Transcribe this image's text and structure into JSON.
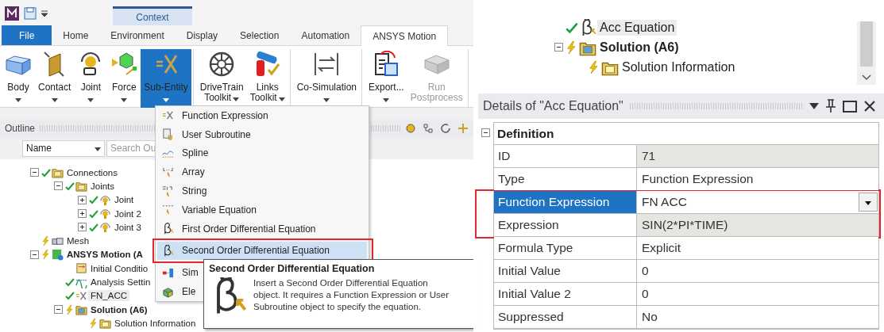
{
  "quick_access": {
    "context_tab": "Context"
  },
  "ribbon_tabs": [
    {
      "label": "File",
      "kind": "file",
      "selected": false
    },
    {
      "label": "Home",
      "kind": "tab",
      "selected": false
    },
    {
      "label": "Environment",
      "kind": "tab",
      "selected": false
    },
    {
      "label": "Display",
      "kind": "tab",
      "selected": false
    },
    {
      "label": "Selection",
      "kind": "tab",
      "selected": false
    },
    {
      "label": "Automation",
      "kind": "tab",
      "selected": false
    },
    {
      "label": "ANSYS Motion",
      "kind": "tab",
      "selected": true
    }
  ],
  "ribbon": {
    "groups": [
      {
        "buttons": [
          {
            "label": "Body",
            "kind": "body",
            "caret": true,
            "selected": false,
            "disabled": false
          },
          {
            "label": "Contact",
            "kind": "contact",
            "caret": true,
            "selected": false,
            "disabled": false
          },
          {
            "label": "Joint",
            "kind": "joint",
            "caret": true,
            "selected": false,
            "disabled": false
          },
          {
            "label": "Force",
            "kind": "force",
            "caret": true,
            "selected": false,
            "disabled": false
          },
          {
            "label": "Sub-Entity",
            "kind": "subentity",
            "caret": true,
            "selected": true,
            "disabled": false
          }
        ]
      },
      {
        "buttons": [
          {
            "label": "DriveTrain Toolkit",
            "kind": "drivetrain",
            "caret": true,
            "selected": false,
            "disabled": false
          },
          {
            "label": "Links Toolkit",
            "kind": "links",
            "caret": true,
            "selected": false,
            "disabled": false
          }
        ]
      },
      {
        "buttons": [
          {
            "label": "Co-Simulation",
            "kind": "cosim",
            "caret": true,
            "selected": false,
            "disabled": false
          }
        ]
      },
      {
        "buttons": [
          {
            "label": "Export...",
            "kind": "export",
            "caret": true,
            "selected": false,
            "disabled": false
          },
          {
            "label": "Run Postprocess",
            "kind": "postprocess",
            "caret": false,
            "selected": false,
            "disabled": true
          }
        ]
      }
    ]
  },
  "outline": {
    "title": "Outline",
    "filter": {
      "value": "Name"
    },
    "search": {
      "placeholder": "Search Ou"
    },
    "tree": [
      {
        "label": "Connections",
        "kind": "folder",
        "checked": true,
        "needs_update": false,
        "expanded": true,
        "bold": false,
        "selected": false,
        "children": [
          {
            "label": "Joints",
            "kind": "joints",
            "checked": true,
            "needs_update": false,
            "expanded": true,
            "bold": false,
            "selected": false,
            "children": [
              {
                "label": "Joint",
                "kind": "joint",
                "checked": true,
                "needs_update": false,
                "expanded": false,
                "bold": false,
                "selected": false
              },
              {
                "label": "Joint 2",
                "kind": "joint",
                "checked": true,
                "needs_update": false,
                "expanded": false,
                "bold": false,
                "selected": false
              },
              {
                "label": "Joint 3",
                "kind": "joint",
                "checked": true,
                "needs_update": false,
                "expanded": false,
                "bold": false,
                "selected": false
              }
            ]
          }
        ]
      },
      {
        "label": "Mesh",
        "kind": "mesh",
        "checked": false,
        "needs_update": true,
        "bold": false,
        "selected": false
      },
      {
        "label": "ANSYS Motion (A",
        "kind": "motion",
        "checked": false,
        "needs_update": true,
        "expanded": true,
        "bold": true,
        "selected": false,
        "children": [
          {
            "label": "Initial Conditio",
            "kind": "conditions",
            "checked": false,
            "needs_update": false,
            "bold": false,
            "selected": false
          },
          {
            "label": "Analysis Settin",
            "kind": "settings",
            "checked": true,
            "needs_update": false,
            "bold": false,
            "selected": false
          },
          {
            "label": "FN_ACC",
            "kind": "function",
            "checked": true,
            "needs_update": false,
            "bold": false,
            "selected": true
          },
          {
            "label": "Solution (A6)",
            "kind": "solution",
            "checked": false,
            "needs_update": true,
            "expanded": true,
            "bold": true,
            "selected": false,
            "children": [
              {
                "label": "Solution Information",
                "kind": "info",
                "checked": false,
                "needs_update": true,
                "bold": false,
                "selected": false
              }
            ]
          }
        ]
      }
    ]
  },
  "menu": {
    "items": [
      {
        "label": "Function Expression",
        "kind": "function",
        "selected": false,
        "framed": false
      },
      {
        "label": "User Subroutine",
        "kind": "subroutine",
        "selected": false,
        "framed": false
      },
      {
        "label": "Spline",
        "kind": "spline",
        "selected": false,
        "framed": false
      },
      {
        "label": "Array",
        "kind": "array",
        "selected": false,
        "framed": false
      },
      {
        "label": "String",
        "kind": "string",
        "selected": false,
        "framed": false
      },
      {
        "label": "Variable Equation",
        "kind": "variable",
        "selected": false,
        "framed": false
      },
      {
        "label": "First Order Differential Equation",
        "kind": "first_order",
        "selected": false,
        "framed": false
      },
      {
        "label": "Second Order Differential Equation",
        "kind": "second_order",
        "selected": true,
        "framed": true
      },
      {
        "label": "Sim",
        "kind": "simulink",
        "selected": false,
        "framed": false
      },
      {
        "label": "Ele",
        "kind": "element",
        "selected": false,
        "framed": false
      }
    ]
  },
  "tooltip": {
    "title": "Second Order Differential Equation",
    "text": "Insert a Second Order Differential Equation object. It requires a Function Expression or User Subroutine object to specify the equation."
  },
  "right_tree": [
    {
      "label": "Acc Equation",
      "kind": "second_order",
      "checked": true,
      "needs_update": false,
      "bold": false,
      "selected": true
    },
    {
      "label": "Solution (A6)",
      "kind": "solution",
      "checked": false,
      "needs_update": true,
      "expanded": true,
      "bold": true,
      "selected": false,
      "children": [
        {
          "label": "Solution Information",
          "kind": "info",
          "checked": false,
          "needs_update": true,
          "bold": false,
          "selected": false
        }
      ]
    }
  ],
  "details": {
    "title": "Details of \"Acc Equation\"",
    "group": {
      "label": "Definition",
      "expanded": true
    },
    "rows": [
      {
        "label": "ID",
        "value": "71",
        "kind": "text",
        "readonly": true,
        "selected": false,
        "framed": false
      },
      {
        "label": "Type",
        "value": "Function Expression",
        "kind": "text",
        "readonly": false,
        "selected": false,
        "framed": false
      },
      {
        "label": "Function Expression",
        "value": "FN ACC",
        "kind": "dropdown",
        "readonly": false,
        "selected": true,
        "framed": true
      },
      {
        "label": "Expression",
        "value": "SIN(2*PI*TIME)",
        "kind": "text",
        "readonly": true,
        "selected": false,
        "framed": true
      },
      {
        "label": "Formula Type",
        "value": "Explicit",
        "kind": "text",
        "readonly": false,
        "selected": false,
        "framed": false
      },
      {
        "label": "Initial Value",
        "value": "0",
        "kind": "text",
        "readonly": false,
        "selected": false,
        "framed": false
      },
      {
        "label": "Initial Value 2",
        "value": "0",
        "kind": "text",
        "readonly": false,
        "selected": false,
        "framed": false
      },
      {
        "label": "Suppressed",
        "value": "No",
        "kind": "text",
        "readonly": false,
        "selected": false,
        "framed": false
      }
    ]
  }
}
